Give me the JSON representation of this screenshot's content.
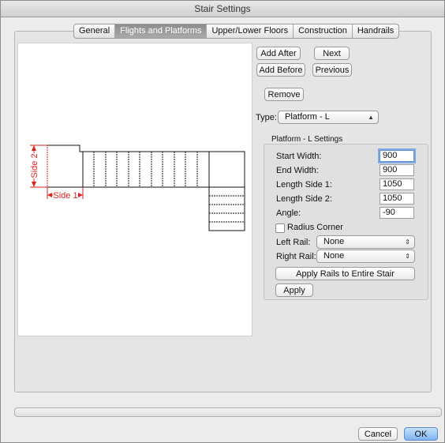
{
  "window": {
    "title": "Stair Settings"
  },
  "tabs": [
    {
      "label": "General",
      "active": false
    },
    {
      "label": "Flights and Platforms",
      "active": true
    },
    {
      "label": "Upper/Lower Floors",
      "active": false
    },
    {
      "label": "Construction",
      "active": false
    },
    {
      "label": "Handrails",
      "active": false
    }
  ],
  "diagram": {
    "side2_label": "Side 2",
    "side1_label": "Side 1",
    "accent_color": "#e0201b"
  },
  "flight_buttons": {
    "add_after": "Add After",
    "next": "Next",
    "add_before": "Add Before",
    "previous": "Previous",
    "remove": "Remove"
  },
  "type_select": {
    "label": "Type:",
    "value": "Platform - L"
  },
  "platform_settings": {
    "title": "Platform - L Settings",
    "start_width_label": "Start Width:",
    "start_width": "900",
    "end_width_label": "End Width:",
    "end_width": "900",
    "length_side1_label": "Length Side 1:",
    "length_side1": "1050",
    "length_side2_label": "Length Side 2:",
    "length_side2": "1050",
    "angle_label": "Angle:",
    "angle": "-90",
    "radius_corner_label": "Radius Corner",
    "radius_corner_checked": false,
    "left_rail_label": "Left Rail:",
    "left_rail": "None",
    "right_rail_label": "Right Rail:",
    "right_rail": "None",
    "apply_rails_label": "Apply Rails to Entire Stair",
    "apply_label": "Apply"
  },
  "footer": {
    "cancel": "Cancel",
    "ok": "OK"
  }
}
